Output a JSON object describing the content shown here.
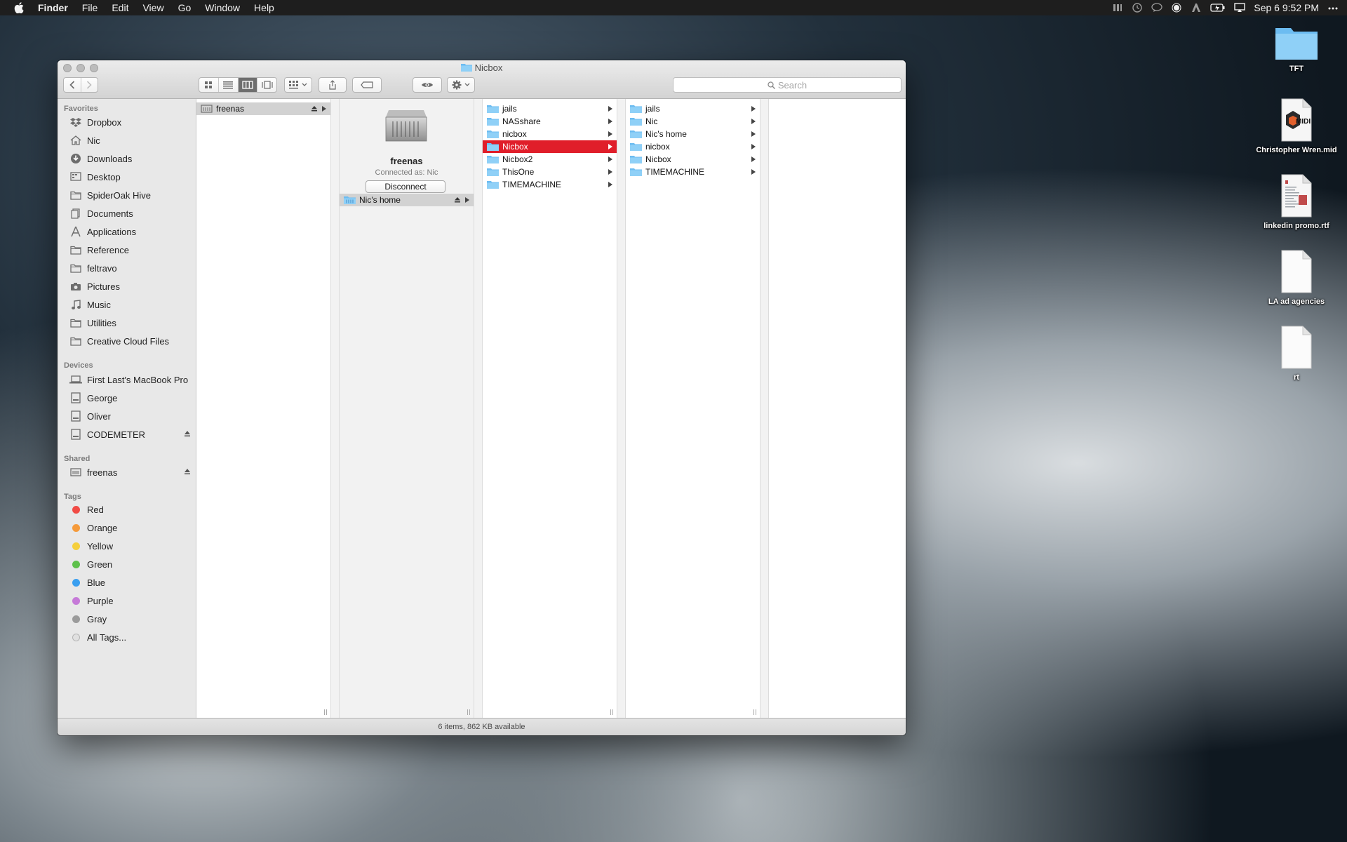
{
  "menubar": {
    "app": "Finder",
    "items": [
      "File",
      "Edit",
      "View",
      "Go",
      "Window",
      "Help"
    ],
    "clock": "Sep 6  9:52 PM"
  },
  "window": {
    "title": "Nicbox",
    "search_placeholder": "Search",
    "status": "6 items, 862 KB available"
  },
  "sidebar": {
    "favorites_header": "Favorites",
    "favorites": [
      {
        "label": "Dropbox",
        "icon": "dropbox-icon"
      },
      {
        "label": "Nic",
        "icon": "home-icon"
      },
      {
        "label": "Downloads",
        "icon": "downloads-icon"
      },
      {
        "label": "Desktop",
        "icon": "desktop-icon"
      },
      {
        "label": "SpiderOak Hive",
        "icon": "folder-icon"
      },
      {
        "label": "Documents",
        "icon": "documents-icon"
      },
      {
        "label": "Applications",
        "icon": "applications-icon"
      },
      {
        "label": "Reference",
        "icon": "folder-icon"
      },
      {
        "label": "feltravo",
        "icon": "folder-icon"
      },
      {
        "label": "Pictures",
        "icon": "camera-icon"
      },
      {
        "label": "Music",
        "icon": "music-icon"
      },
      {
        "label": "Utilities",
        "icon": "folder-icon"
      },
      {
        "label": "Creative Cloud Files",
        "icon": "folder-icon"
      }
    ],
    "devices_header": "Devices",
    "devices": [
      {
        "label": "First  Last's MacBook Pro",
        "icon": "laptop-icon"
      },
      {
        "label": "George",
        "icon": "disk-icon"
      },
      {
        "label": "Oliver",
        "icon": "disk-icon"
      },
      {
        "label": "CODEMETER",
        "icon": "disk-icon"
      }
    ],
    "shared_header": "Shared",
    "shared": [
      {
        "label": "freenas",
        "icon": "server-icon"
      }
    ],
    "tags_header": "Tags",
    "tags": [
      {
        "label": "Red",
        "color": "#f14b45"
      },
      {
        "label": "Orange",
        "color": "#f59a3a"
      },
      {
        "label": "Yellow",
        "color": "#f5cf3c"
      },
      {
        "label": "Green",
        "color": "#5ec14b"
      },
      {
        "label": "Blue",
        "color": "#3a9ff0"
      },
      {
        "label": "Purple",
        "color": "#c67ad8"
      },
      {
        "label": "Gray",
        "color": "#9b9b9b"
      },
      {
        "label": "All Tags...",
        "color": "#e0e0e0"
      }
    ]
  },
  "columns": {
    "col1": [
      {
        "label": "freenas"
      }
    ],
    "server": {
      "name": "freenas",
      "connected": "Connected as: Nic",
      "disconnect": "Disconnect",
      "share": "Nic's home"
    },
    "col3": [
      {
        "label": "jails"
      },
      {
        "label": "NASshare"
      },
      {
        "label": "nicbox"
      },
      {
        "label": "Nicbox"
      },
      {
        "label": "Nicbox2"
      },
      {
        "label": "ThisOne"
      },
      {
        "label": "TIMEMACHINE"
      }
    ],
    "col4": [
      {
        "label": "jails"
      },
      {
        "label": "Nic"
      },
      {
        "label": "Nic's home"
      },
      {
        "label": "nicbox"
      },
      {
        "label": "Nicbox"
      },
      {
        "label": "TIMEMACHINE"
      }
    ]
  },
  "desktop": [
    {
      "label": "TFT",
      "kind": "folder-icon"
    },
    {
      "label": "Christopher Wren.mid",
      "kind": "midi-file-icon",
      "badge": "MIDI"
    },
    {
      "label": "linkedin promo.rtf",
      "kind": "rtf-file-icon"
    },
    {
      "label": "LA ad agencies",
      "kind": "document-icon"
    },
    {
      "label": "rt",
      "kind": "document-icon"
    }
  ]
}
